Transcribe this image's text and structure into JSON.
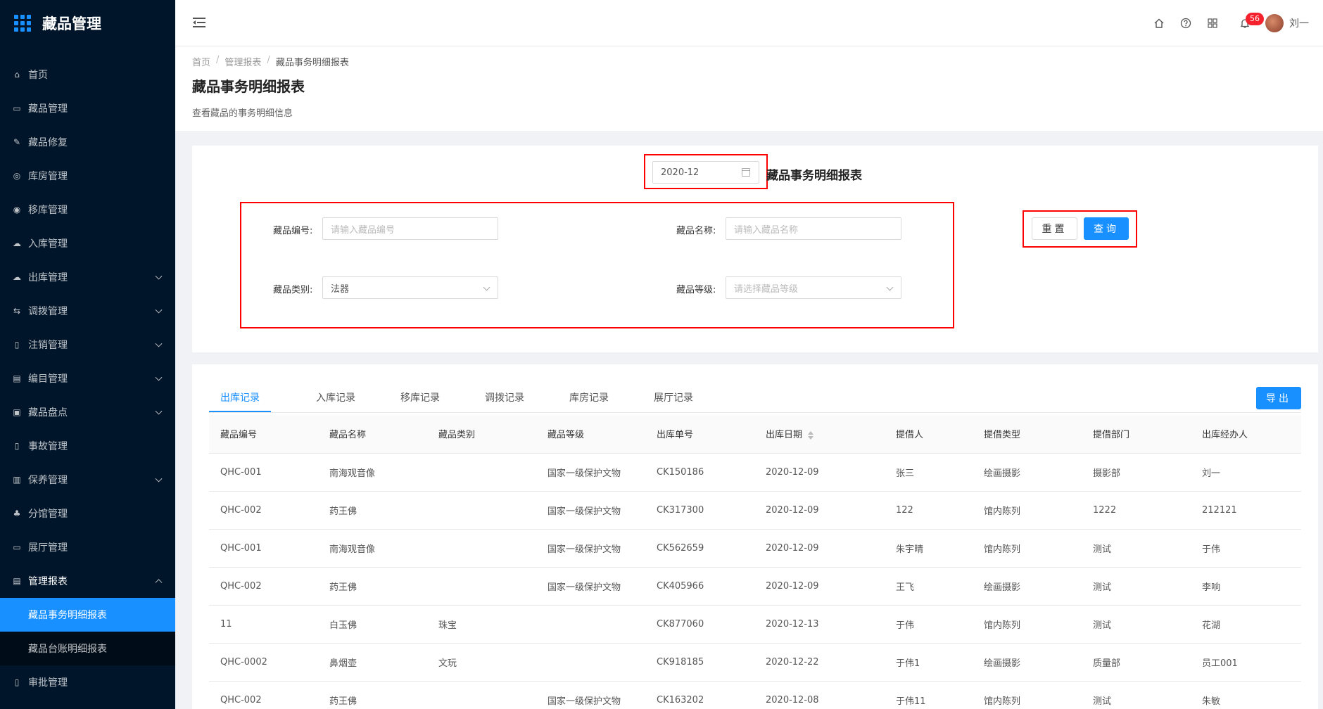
{
  "app": {
    "title": "藏品管理"
  },
  "sidebar": {
    "items": [
      {
        "label": "首页",
        "icon": "home-icon"
      },
      {
        "label": "藏品管理",
        "icon": "calendar-icon"
      },
      {
        "label": "藏品修复",
        "icon": "wrench-icon"
      },
      {
        "label": "库房管理",
        "icon": "warehouse-icon"
      },
      {
        "label": "移库管理",
        "icon": "move-icon"
      },
      {
        "label": "入库管理",
        "icon": "cloud-upload-icon"
      },
      {
        "label": "出库管理",
        "icon": "cloud-download-icon",
        "expandable": true
      },
      {
        "label": "调拨管理",
        "icon": "transfer-icon",
        "expandable": true
      },
      {
        "label": "注销管理",
        "icon": "file-icon",
        "expandable": true
      },
      {
        "label": "编目管理",
        "icon": "catalog-icon",
        "expandable": true
      },
      {
        "label": "藏品盘点",
        "icon": "inventory-icon",
        "expandable": true
      },
      {
        "label": "事故管理",
        "icon": "accident-icon"
      },
      {
        "label": "保养管理",
        "icon": "maintain-icon",
        "expandable": true
      },
      {
        "label": "分馆管理",
        "icon": "branch-icon"
      },
      {
        "label": "展厅管理",
        "icon": "monitor-icon"
      },
      {
        "label": "管理报表",
        "icon": "report-icon",
        "open": true
      },
      {
        "label": "审批管理",
        "icon": "approve-icon"
      }
    ],
    "submenu": [
      {
        "label": "藏品事务明细报表",
        "active": true
      },
      {
        "label": "藏品台账明细报表",
        "active": false
      }
    ]
  },
  "header": {
    "notifications": "56",
    "username": "刘一",
    "icons": [
      "home-icon",
      "help-icon",
      "apps-icon",
      "bell-icon"
    ]
  },
  "page": {
    "breadcrumb": [
      "首页",
      "管理报表",
      "藏品事务明细报表"
    ],
    "title": "藏品事务明细报表",
    "description": "查看藏品的事务明细信息"
  },
  "filter": {
    "month": "2020-12",
    "report_title": "藏品事务明细报表",
    "code_label": "藏品编号:",
    "code_placeholder": "请输入藏品编号",
    "name_label": "藏品名称:",
    "name_placeholder": "请输入藏品名称",
    "category_label": "藏品类别:",
    "category_value": "法器",
    "level_label": "藏品等级:",
    "level_placeholder": "请选择藏品等级",
    "reset_label": "重置",
    "query_label": "查询"
  },
  "records": {
    "tabs": [
      "出库记录",
      "入库记录",
      "移库记录",
      "调拨记录",
      "库房记录",
      "展厅记录"
    ],
    "active_tab": 0,
    "export_label": "导出",
    "columns": [
      "藏品编号",
      "藏品名称",
      "藏品类别",
      "藏品等级",
      "出库单号",
      "出库日期",
      "提借人",
      "提借类型",
      "提借部门",
      "出库经办人"
    ],
    "rows": [
      [
        "QHC-001",
        "南海观音像",
        "",
        "国家一级保护文物",
        "CK150186",
        "2020-12-09",
        "张三",
        "绘画摄影",
        "摄影部",
        "刘一"
      ],
      [
        "QHC-002",
        "药王佛",
        "",
        "国家一级保护文物",
        "CK317300",
        "2020-12-09",
        "122",
        "馆内陈列",
        "1222",
        "212121"
      ],
      [
        "QHC-001",
        "南海观音像",
        "",
        "国家一级保护文物",
        "CK562659",
        "2020-12-09",
        "朱宇晴",
        "馆内陈列",
        "测试",
        "于伟"
      ],
      [
        "QHC-002",
        "药王佛",
        "",
        "国家一级保护文物",
        "CK405966",
        "2020-12-09",
        "王飞",
        "绘画摄影",
        "测试",
        "李响"
      ],
      [
        "11",
        "白玉佛",
        "珠宝",
        "",
        "CK877060",
        "2020-12-13",
        "于伟",
        "馆内陈列",
        "测试",
        "花湖"
      ],
      [
        "QHC-0002",
        "鼻烟壶",
        "文玩",
        "",
        "CK918185",
        "2020-12-22",
        "于伟1",
        "绘画摄影",
        "质量部",
        "员工001"
      ],
      [
        "QHC-002",
        "药王佛",
        "",
        "国家一级保护文物",
        "CK163202",
        "2020-12-08",
        "于伟11",
        "馆内陈列",
        "测试",
        "朱敏"
      ]
    ]
  }
}
